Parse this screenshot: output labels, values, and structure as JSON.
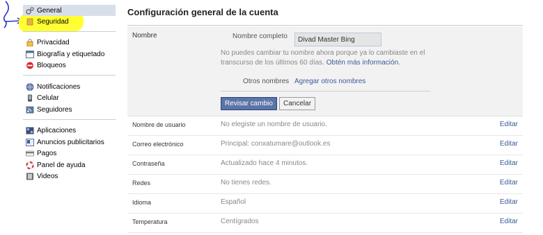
{
  "sidebar": {
    "groups": [
      {
        "items": [
          {
            "label": "General",
            "icon": "gear-icon",
            "selected": true
          },
          {
            "label": "Seguridad",
            "icon": "shield-icon",
            "selected": false
          }
        ]
      },
      {
        "items": [
          {
            "label": "Privacidad",
            "icon": "lock-icon"
          },
          {
            "label": "Biografía y etiquetado",
            "icon": "timeline-icon"
          },
          {
            "label": "Bloqueos",
            "icon": "block-icon"
          }
        ]
      },
      {
        "items": [
          {
            "label": "Notificaciones",
            "icon": "globe-icon"
          },
          {
            "label": "Celular",
            "icon": "phone-icon"
          },
          {
            "label": "Seguidores",
            "icon": "rss-icon"
          }
        ]
      },
      {
        "items": [
          {
            "label": "Aplicaciones",
            "icon": "apps-icon"
          },
          {
            "label": "Anuncios publicitarios",
            "icon": "ads-icon"
          },
          {
            "label": "Pagos",
            "icon": "card-icon"
          },
          {
            "label": "Panel de ayuda",
            "icon": "lifebuoy-icon"
          },
          {
            "label": "Videos",
            "icon": "film-icon"
          }
        ]
      }
    ]
  },
  "main": {
    "title": "Configuración general de la cuenta",
    "name_panel": {
      "heading": "Nombre",
      "full_name_label": "Nombre completo",
      "full_name_value": "Divad Master Bing",
      "notice_text": "No puedes cambiar tu nombre ahora porque ya lo cambiaste en el transcurso de los últimos 60 días.",
      "notice_link": "Obtén más información",
      "notice_end": ".",
      "other_names_label": "Otros nombres",
      "add_other_names": "Agregar otros nombres",
      "review_button": "Revisar cambio",
      "cancel_button": "Cancelar"
    },
    "rows": [
      {
        "label": "Nombre de usuario",
        "value": "No elegiste un nombre de usuario.",
        "action": "Editar"
      },
      {
        "label": "Correo electrónico",
        "value": "Principal: conxatumare@outlook.es",
        "action": "Editar"
      },
      {
        "label": "Contraseña",
        "value": "Actualizado hace 4 minutos.",
        "action": "Editar"
      },
      {
        "label": "Redes",
        "value": "No tienes redes.",
        "action": "Editar"
      },
      {
        "label": "Idioma",
        "value": "Español",
        "action": "Editar"
      },
      {
        "label": "Temperatura",
        "value": "Centígrados",
        "action": "Editar"
      }
    ]
  },
  "colors": {
    "link": "#3b5998",
    "selected_bg": "#d8dfea",
    "highlight": "#ffff33",
    "primary_button": "#5b74a8"
  }
}
